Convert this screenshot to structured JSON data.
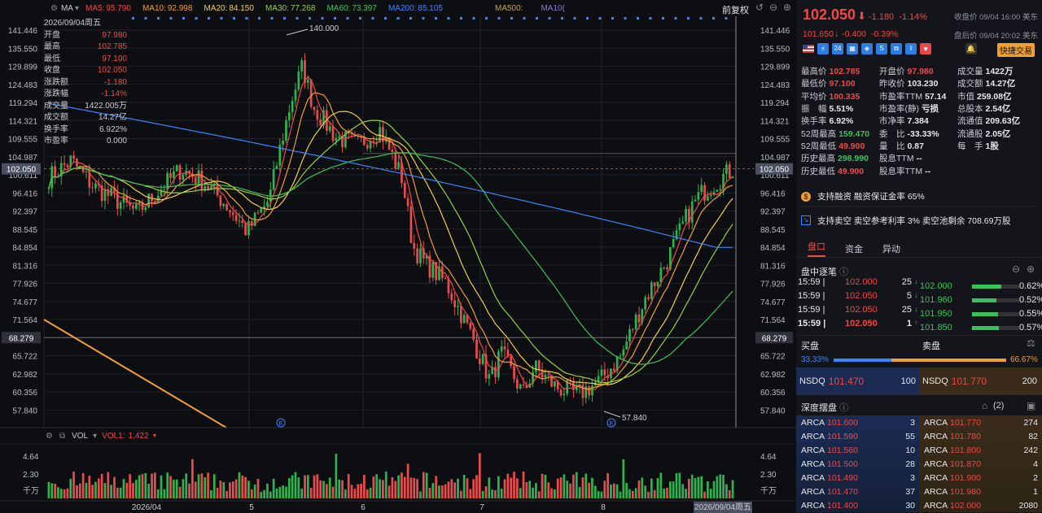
{
  "ma": {
    "label": "MA",
    "ma5": "MA5:",
    "ma5v": "95.790",
    "ma10": "MA10:",
    "ma10v": "92.998",
    "ma20": "MA20:",
    "ma20v": "84.150",
    "ma30": "MA30:",
    "ma30v": "77.268",
    "ma60": "MA60:",
    "ma60v": "73.397",
    "ma200": "MA200:",
    "ma200v": "85.105",
    "ma500": "MA500:",
    "ma100": "MA10(",
    "fuquan": "前复权"
  },
  "ohlc": [
    {
      "k": "2026/09/04周五",
      "v": ""
    },
    {
      "k": "开盘",
      "v": "97.980"
    },
    {
      "k": "最高",
      "v": "102.785"
    },
    {
      "k": "最低",
      "v": "97.100"
    },
    {
      "k": "收盘",
      "v": "102.050"
    },
    {
      "k": "涨跌额",
      "v": "-1.180"
    },
    {
      "k": "涨跌幅",
      "v": "-1.14%"
    },
    {
      "k": "成交量",
      "v": "1422.005万"
    },
    {
      "k": "成交额",
      "v": "14.27亿"
    },
    {
      "k": "换手率",
      "v": "6.922%"
    },
    {
      "k": "市盈率",
      "v": "0.000"
    }
  ],
  "axis": {
    "prices": [
      "141.446",
      "135.550",
      "129.899",
      "124.483",
      "119.294",
      "114.321",
      "109.555",
      "104.987",
      "100.611",
      "96.416",
      "92.397",
      "88.545",
      "84.854",
      "81.316",
      "77.926",
      "74.677",
      "71.564",
      "68.279",
      "65.722",
      "62.982",
      "60.356",
      "57.840"
    ],
    "current": "102.050",
    "line2": "68.279",
    "high": "140.000",
    "low": "57.840",
    "dates": [
      "2026/04",
      "5",
      "6",
      "7",
      "8",
      "2026/09/04周五"
    ],
    "vol": [
      "4.64",
      "2.30",
      "千万"
    ]
  },
  "vol": {
    "label": "VOL",
    "vol1": "VOL1:",
    "vol1v": "1.422"
  },
  "header": {
    "price": "102.050",
    "arrow": "⬇",
    "chg": "-1.180",
    "pct": "-1.14%",
    "close_label": "收盘价 09/04 16:00 美东",
    "after": "101.650",
    "after_chg": "-0.400",
    "after_pct": "-0.39%",
    "after_label": "盘后价 09/04 20:02 美东",
    "quick": "快捷交易"
  },
  "stats": [
    [
      [
        "最高价",
        "102.785",
        "red"
      ],
      [
        "开盘价",
        "97.980",
        "red"
      ],
      [
        "成交量",
        "1422万",
        "white"
      ]
    ],
    [
      [
        "最低价",
        "97.100",
        "red"
      ],
      [
        "昨收价",
        "103.230",
        "white"
      ],
      [
        "成交额",
        "14.27亿",
        "white"
      ]
    ],
    [
      [
        "平均价",
        "100.335",
        "red"
      ],
      [
        "市盈率TTM",
        "57.14",
        "white"
      ],
      [
        "市值",
        "259.08亿",
        "white"
      ]
    ],
    [
      [
        "振　幅",
        "5.51%",
        "white"
      ],
      [
        "市盈率(静)",
        "亏损",
        "white"
      ],
      [
        "总股本",
        "2.54亿",
        "white"
      ]
    ],
    [
      [
        "换手率",
        "6.92%",
        "white"
      ],
      [
        "市净率",
        "7.384",
        "white"
      ],
      [
        "流通值",
        "209.63亿",
        "white"
      ]
    ],
    [
      [
        "52周最高",
        "159.470",
        "green"
      ],
      [
        "委　比",
        "-33.33%",
        "white"
      ],
      [
        "流通股",
        "2.05亿",
        "white"
      ]
    ],
    [
      [
        "52周最低",
        "49.900",
        "red"
      ],
      [
        "量　比",
        "0.87",
        "white"
      ],
      [
        "每　手",
        "1股",
        "white"
      ]
    ],
    [
      [
        "历史最高",
        "298.990",
        "green"
      ],
      [
        "股息TTM",
        "--",
        "white"
      ],
      [
        "",
        "",
        " "
      ]
    ],
    [
      [
        "历史最低",
        "49.900",
        "red"
      ],
      [
        "股息率TTM",
        "--",
        "white"
      ],
      [
        "",
        "",
        " "
      ]
    ]
  ],
  "info1": "支持融资 融资保证金率 65%",
  "info2": "支持卖空 卖空参考利率 3% 卖空池剩余 708.69万股",
  "tabs": [
    "盘口",
    "资金",
    "异动"
  ],
  "trades_title": "盘中逐笔",
  "trades": [
    {
      "t": "15:59",
      "p": "102.000",
      "q": "25"
    },
    {
      "t": "15:59",
      "p": "102.050",
      "q": "5"
    },
    {
      "t": "15:59",
      "p": "102.050",
      "q": "25"
    },
    {
      "t": "15:59",
      "p": "102.050",
      "q": "1"
    }
  ],
  "book": [
    {
      "p": "102.000",
      "pc": "0.62%",
      "f": 0.62
    },
    {
      "p": "101.960",
      "pc": "0.52%",
      "f": 0.52
    },
    {
      "p": "101.950",
      "pc": "0.55%",
      "f": 0.55
    },
    {
      "p": "101.850",
      "pc": "0.57%",
      "f": 0.57
    }
  ],
  "bidask": {
    "bid": "买盘",
    "ask": "卖盘",
    "bid_pct": "33.33%",
    "ask_pct": "66.67%",
    "bid_frac": 0.3333,
    "nsdq": "NSDQ",
    "bid_p": "101.470",
    "bid_q": "100",
    "ask_p": "101.770",
    "ask_q": "200"
  },
  "depth_title": "深度摆盘",
  "depth_count": "(2)",
  "depth_bids": [
    {
      "ex": "ARCA",
      "p": "101.600",
      "q": "3"
    },
    {
      "ex": "ARCA",
      "p": "101.590",
      "q": "55"
    },
    {
      "ex": "ARCA",
      "p": "101.560",
      "q": "10"
    },
    {
      "ex": "ARCA",
      "p": "101.500",
      "q": "28"
    },
    {
      "ex": "ARCA",
      "p": "101.490",
      "q": "3"
    },
    {
      "ex": "ARCA",
      "p": "101.470",
      "q": "37"
    },
    {
      "ex": "ARCA",
      "p": "101.400",
      "q": "30"
    }
  ],
  "depth_asks": [
    {
      "ex": "ARCA",
      "p": "101.770",
      "q": "274"
    },
    {
      "ex": "ARCA",
      "p": "101.780",
      "q": "82"
    },
    {
      "ex": "ARCA",
      "p": "101.800",
      "q": "242"
    },
    {
      "ex": "ARCA",
      "p": "101.870",
      "q": "4"
    },
    {
      "ex": "ARCA",
      "p": "101.900",
      "q": "2"
    },
    {
      "ex": "ARCA",
      "p": "101.980",
      "q": "1"
    },
    {
      "ex": "ARCA",
      "p": "102.000",
      "q": "2080"
    }
  ]
}
